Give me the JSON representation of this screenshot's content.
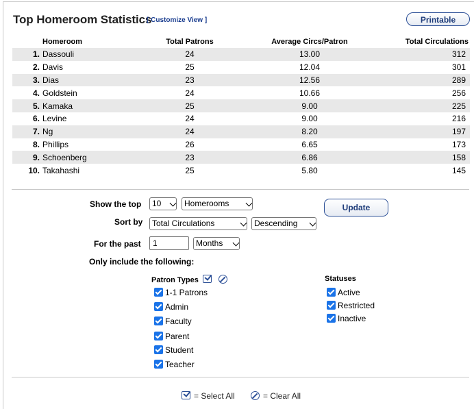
{
  "header": {
    "title": "Top Homeroom Statistics",
    "customize_open": "[",
    "customize_link": "Customize View",
    "customize_close": "]",
    "printable_label": "Printable"
  },
  "table": {
    "columns": [
      "Homeroom",
      "Total Patrons",
      "Average Circs/Patron",
      "Total Circulations"
    ],
    "rows": [
      {
        "rank": "1.",
        "name": "Dassouli",
        "patrons": "24",
        "avg": "13.00",
        "total": "312"
      },
      {
        "rank": "2.",
        "name": "Davis",
        "patrons": "25",
        "avg": "12.04",
        "total": "301"
      },
      {
        "rank": "3.",
        "name": "Dias",
        "patrons": "23",
        "avg": "12.56",
        "total": "289"
      },
      {
        "rank": "4.",
        "name": "Goldstein",
        "patrons": "24",
        "avg": "10.66",
        "total": "256"
      },
      {
        "rank": "5.",
        "name": "Kamaka",
        "patrons": "25",
        "avg": "9.00",
        "total": "225"
      },
      {
        "rank": "6.",
        "name": "Levine",
        "patrons": "24",
        "avg": "9.00",
        "total": "216"
      },
      {
        "rank": "7.",
        "name": "Ng",
        "patrons": "24",
        "avg": "8.20",
        "total": "197"
      },
      {
        "rank": "8.",
        "name": "Phillips",
        "patrons": "26",
        "avg": "6.65",
        "total": "173"
      },
      {
        "rank": "9.",
        "name": "Schoenberg",
        "patrons": "23",
        "avg": "6.86",
        "total": "158"
      },
      {
        "rank": "10.",
        "name": "Takahashi",
        "patrons": "25",
        "avg": "5.80",
        "total": "145"
      }
    ]
  },
  "form": {
    "show_top_label": "Show the top",
    "show_top_value": "10",
    "show_top_type": "Homerooms",
    "sort_by_label": "Sort by",
    "sort_by_value": "Total Circulations",
    "sort_order_value": "Descending",
    "for_past_label": "For the past",
    "for_past_value": "1",
    "for_past_unit": "Months",
    "only_include_label": "Only include the following:",
    "update_label": "Update"
  },
  "patron_types": {
    "title": "Patron Types",
    "items": [
      "1-1 Patrons",
      "Admin",
      "Faculty",
      "Parent",
      "Student",
      "Teacher"
    ]
  },
  "statuses": {
    "title": "Statuses",
    "items": [
      "Active",
      "Restricted",
      "Inactive"
    ]
  },
  "legend": {
    "select_all": "= Select All",
    "clear_all": "= Clear All"
  }
}
